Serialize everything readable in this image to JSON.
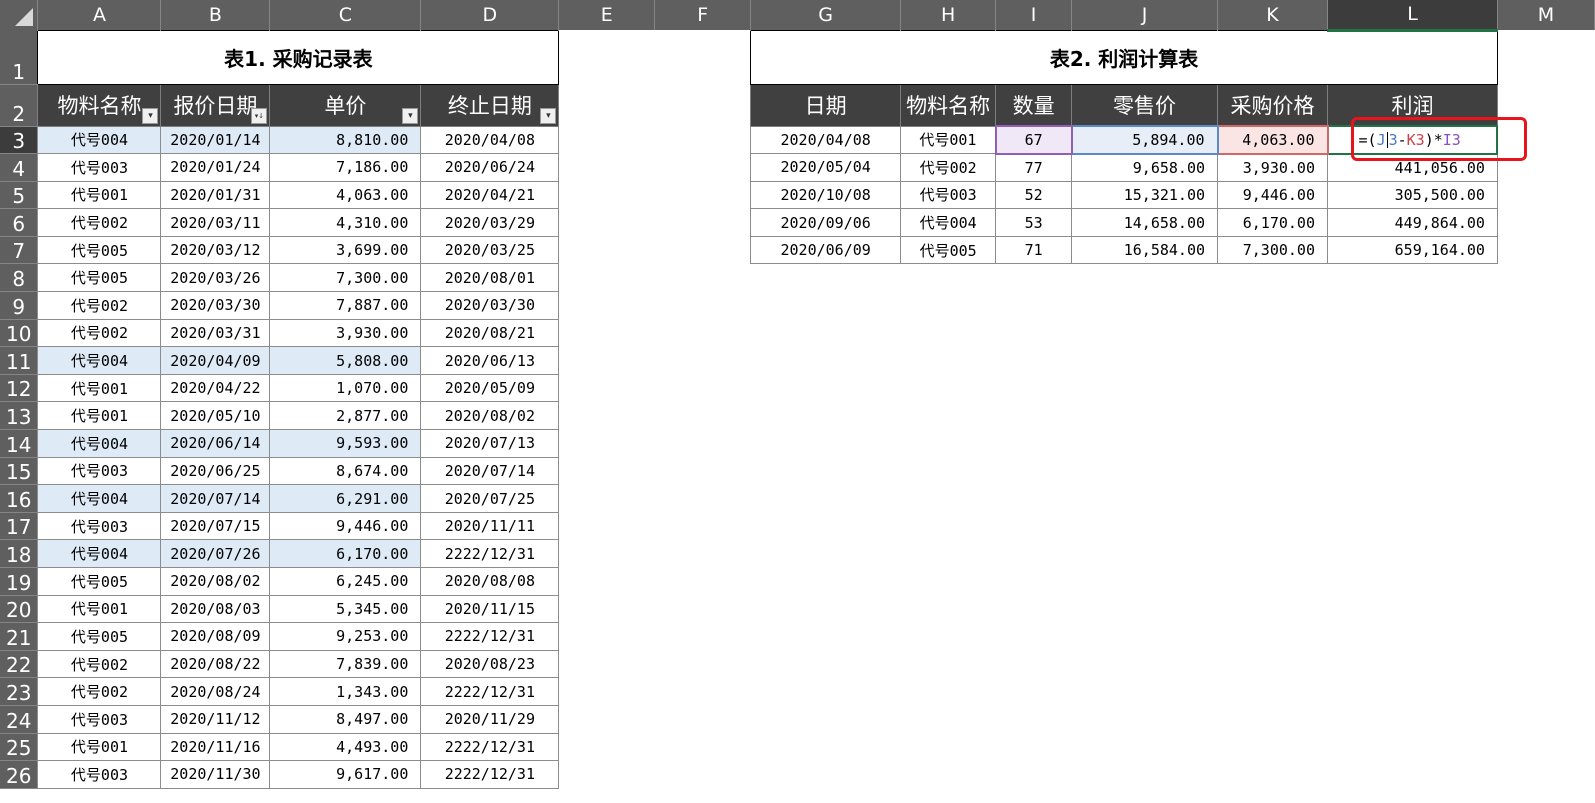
{
  "columns": [
    "A",
    "B",
    "C",
    "D",
    "E",
    "F",
    "G",
    "H",
    "I",
    "J",
    "K",
    "L",
    "M"
  ],
  "selected_column": "L",
  "rows": [
    "1",
    "2",
    "3",
    "4",
    "5",
    "6",
    "7",
    "8",
    "9",
    "10",
    "11",
    "12",
    "13",
    "14",
    "15",
    "16",
    "17",
    "18",
    "19",
    "20",
    "21",
    "22",
    "23",
    "24",
    "25",
    "26"
  ],
  "selected_row": "3",
  "table1": {
    "title": "表1. 采购记录表",
    "headers": [
      "物料名称",
      "报价日期",
      "单价",
      "终止日期"
    ],
    "rows": [
      {
        "name": "代号004",
        "date": "2020/01/14",
        "price": "8,810.00",
        "end": "2020/04/08",
        "hl": true
      },
      {
        "name": "代号003",
        "date": "2020/01/24",
        "price": "7,186.00",
        "end": "2020/06/24",
        "hl": false
      },
      {
        "name": "代号001",
        "date": "2020/01/31",
        "price": "4,063.00",
        "end": "2020/04/21",
        "hl": false
      },
      {
        "name": "代号002",
        "date": "2020/03/11",
        "price": "4,310.00",
        "end": "2020/03/29",
        "hl": false
      },
      {
        "name": "代号005",
        "date": "2020/03/12",
        "price": "3,699.00",
        "end": "2020/03/25",
        "hl": false
      },
      {
        "name": "代号005",
        "date": "2020/03/26",
        "price": "7,300.00",
        "end": "2020/08/01",
        "hl": false
      },
      {
        "name": "代号002",
        "date": "2020/03/30",
        "price": "7,887.00",
        "end": "2020/03/30",
        "hl": false
      },
      {
        "name": "代号002",
        "date": "2020/03/31",
        "price": "3,930.00",
        "end": "2020/08/21",
        "hl": false
      },
      {
        "name": "代号004",
        "date": "2020/04/09",
        "price": "5,808.00",
        "end": "2020/06/13",
        "hl": true
      },
      {
        "name": "代号001",
        "date": "2020/04/22",
        "price": "1,070.00",
        "end": "2020/05/09",
        "hl": false
      },
      {
        "name": "代号001",
        "date": "2020/05/10",
        "price": "2,877.00",
        "end": "2020/08/02",
        "hl": false
      },
      {
        "name": "代号004",
        "date": "2020/06/14",
        "price": "9,593.00",
        "end": "2020/07/13",
        "hl": true
      },
      {
        "name": "代号003",
        "date": "2020/06/25",
        "price": "8,674.00",
        "end": "2020/07/14",
        "hl": false
      },
      {
        "name": "代号004",
        "date": "2020/07/14",
        "price": "6,291.00",
        "end": "2020/07/25",
        "hl": true
      },
      {
        "name": "代号003",
        "date": "2020/07/15",
        "price": "9,446.00",
        "end": "2020/11/11",
        "hl": false
      },
      {
        "name": "代号004",
        "date": "2020/07/26",
        "price": "6,170.00",
        "end": "2222/12/31",
        "hl": true
      },
      {
        "name": "代号005",
        "date": "2020/08/02",
        "price": "6,245.00",
        "end": "2020/08/08",
        "hl": false
      },
      {
        "name": "代号001",
        "date": "2020/08/03",
        "price": "5,345.00",
        "end": "2020/11/15",
        "hl": false
      },
      {
        "name": "代号005",
        "date": "2020/08/09",
        "price": "9,253.00",
        "end": "2222/12/31",
        "hl": false
      },
      {
        "name": "代号002",
        "date": "2020/08/22",
        "price": "7,839.00",
        "end": "2020/08/23",
        "hl": false
      },
      {
        "name": "代号002",
        "date": "2020/08/24",
        "price": "1,343.00",
        "end": "2222/12/31",
        "hl": false
      },
      {
        "name": "代号003",
        "date": "2020/11/12",
        "price": "8,497.00",
        "end": "2020/11/29",
        "hl": false
      },
      {
        "name": "代号001",
        "date": "2020/11/16",
        "price": "4,493.00",
        "end": "2222/12/31",
        "hl": false
      },
      {
        "name": "代号003",
        "date": "2020/11/30",
        "price": "9,617.00",
        "end": "2222/12/31",
        "hl": false
      }
    ]
  },
  "table2": {
    "title": "表2. 利润计算表",
    "headers": [
      "日期",
      "物料名称",
      "数量",
      "零售价",
      "采购价格",
      "利润"
    ],
    "formula": {
      "eq": "=(",
      "j": "J",
      "caret_after": "3",
      "minus": "-",
      "k": "K3",
      ")star": ")*",
      "i": "I3"
    },
    "rows": [
      {
        "date": "2020/04/08",
        "name": "代号001",
        "qty": "67",
        "retail": "5,894.00",
        "cost": "4,063.00",
        "profit": ""
      },
      {
        "date": "2020/05/04",
        "name": "代号002",
        "qty": "77",
        "retail": "9,658.00",
        "cost": "3,930.00",
        "profit": "441,056.00"
      },
      {
        "date": "2020/10/08",
        "name": "代号003",
        "qty": "52",
        "retail": "15,321.00",
        "cost": "9,446.00",
        "profit": "305,500.00"
      },
      {
        "date": "2020/09/06",
        "name": "代号004",
        "qty": "53",
        "retail": "14,658.00",
        "cost": "6,170.00",
        "profit": "449,864.00"
      },
      {
        "date": "2020/06/09",
        "name": "代号005",
        "qty": "71",
        "retail": "16,584.00",
        "cost": "7,300.00",
        "profit": "659,164.00"
      }
    ]
  }
}
